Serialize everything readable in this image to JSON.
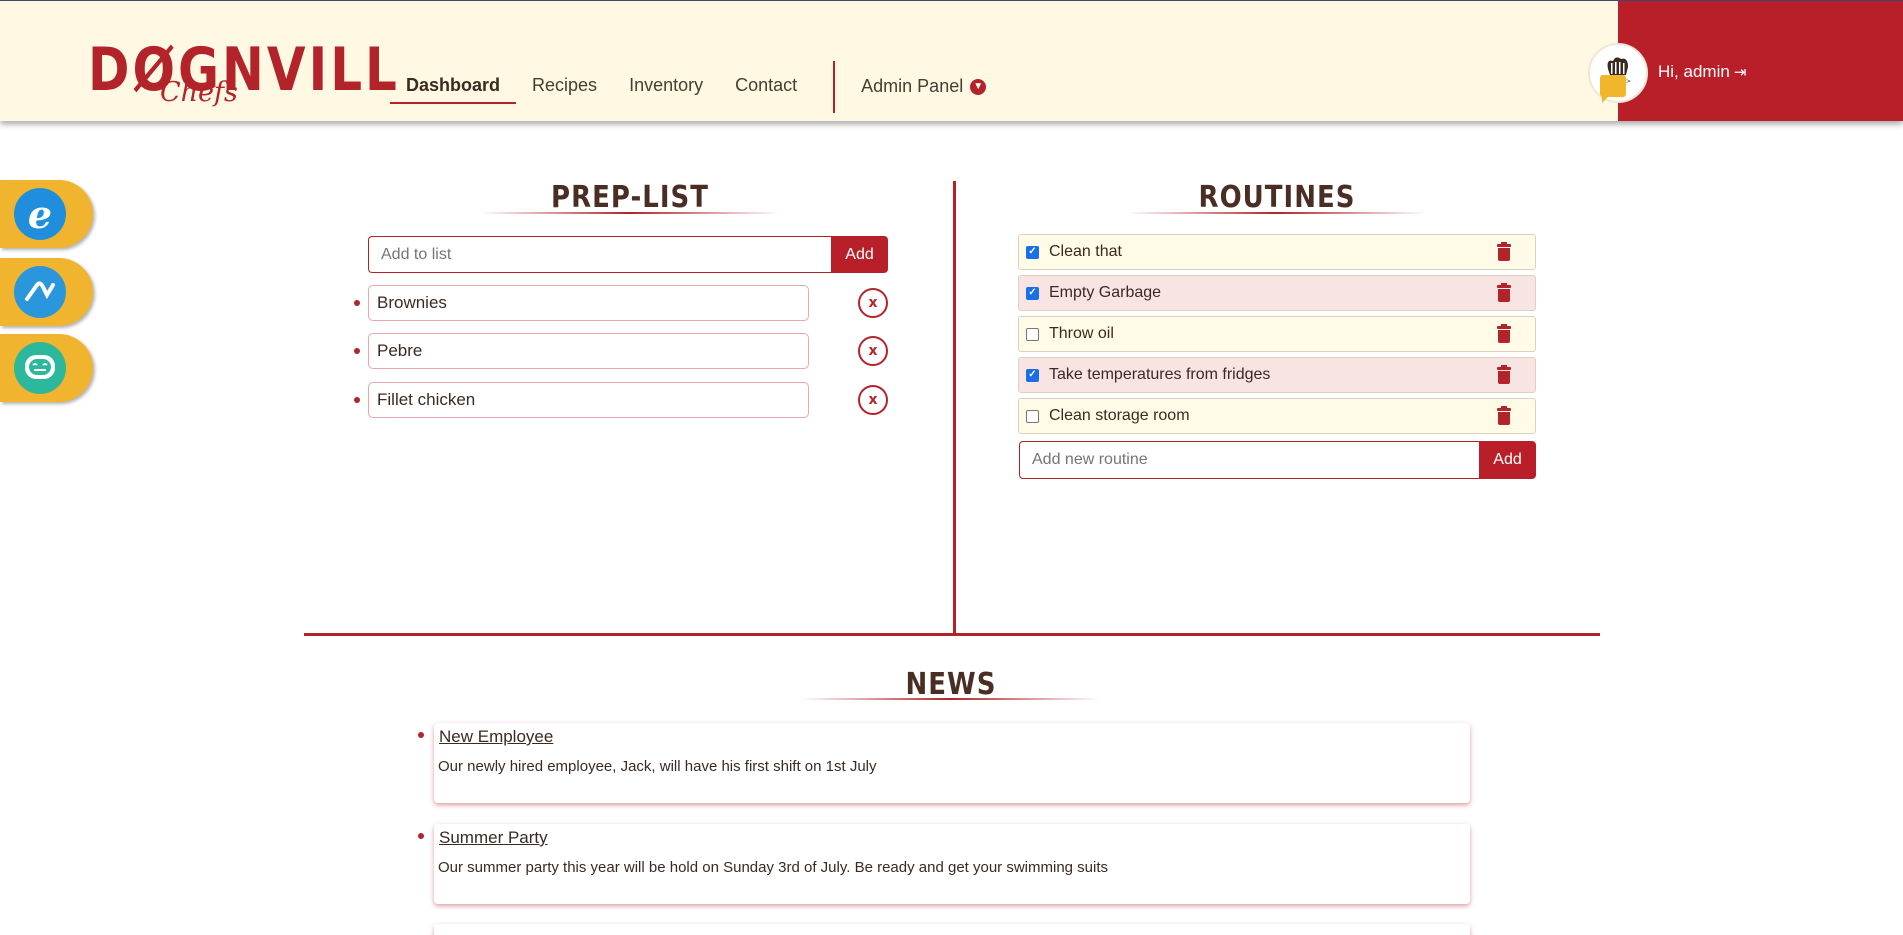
{
  "brand": {
    "name": "DØGNVILL",
    "sub": "Chefs"
  },
  "nav": {
    "items": [
      {
        "label": "Dashboard",
        "active": true
      },
      {
        "label": "Recipes",
        "active": false
      },
      {
        "label": "Inventory",
        "active": false
      },
      {
        "label": "Contact",
        "active": false
      }
    ],
    "admin_label": "Admin Panel"
  },
  "user": {
    "greeting": "Hi, admin"
  },
  "side_tabs": [
    {
      "icon": "e-icon",
      "color": "#1f8fdd"
    },
    {
      "icon": "pulse-icon",
      "color": "#2a97dd"
    },
    {
      "icon": "chatbot-icon",
      "color": "#2cb89a"
    }
  ],
  "prep_list": {
    "title": "PREP-LIST",
    "add_placeholder": "Add to list",
    "add_label": "Add",
    "remove_label": "x",
    "items": [
      "Brownies",
      "Pebre",
      "Fillet chicken"
    ]
  },
  "routines": {
    "title": "ROUTINES",
    "items": [
      {
        "label": "Clean that",
        "checked": true
      },
      {
        "label": "Empty Garbage",
        "checked": true
      },
      {
        "label": "Throw oil",
        "checked": false
      },
      {
        "label": "Take temperatures from fridges",
        "checked": true
      },
      {
        "label": "Clean storage room",
        "checked": false
      }
    ],
    "add_placeholder": "Add new routine",
    "add_label": "Add"
  },
  "news": {
    "title": "NEWS",
    "items": [
      {
        "title": "New Employee",
        "body": "Our newly hired employee, Jack, will have his first shift on 1st July"
      },
      {
        "title": "Summer Party",
        "body": "Our summer party this year will be hold on Sunday 3rd of July. Be ready and get your swimming suits"
      }
    ]
  },
  "colors": {
    "brand_red": "#b3232a",
    "header_bg": "#fff8e3",
    "accent_yellow": "#f0b42e"
  }
}
